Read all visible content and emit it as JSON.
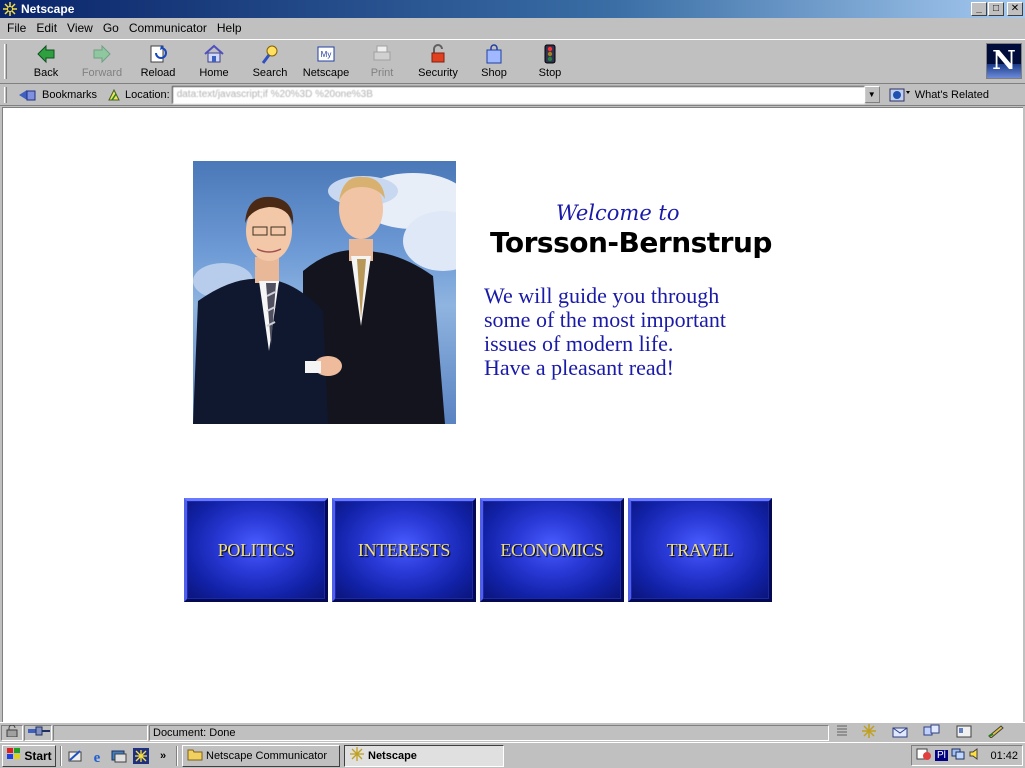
{
  "window": {
    "title": "Netscape",
    "controls": {
      "minimize": "_",
      "maximize": "□",
      "close": "✕"
    }
  },
  "menu": [
    {
      "label": "File"
    },
    {
      "label": "Edit"
    },
    {
      "label": "View"
    },
    {
      "label": "Go"
    },
    {
      "label": "Communicator"
    },
    {
      "label": "Help"
    }
  ],
  "toolbar": {
    "buttons": [
      {
        "label": "Back",
        "icon": "back-arrow-icon",
        "enabled": true
      },
      {
        "label": "Forward",
        "icon": "forward-arrow-icon",
        "enabled": false
      },
      {
        "label": "Reload",
        "icon": "reload-icon",
        "enabled": true
      },
      {
        "label": "Home",
        "icon": "home-icon",
        "enabled": true
      },
      {
        "label": "Search",
        "icon": "search-icon",
        "enabled": true
      },
      {
        "label": "Netscape",
        "icon": "my-netscape-icon",
        "enabled": true
      },
      {
        "label": "Print",
        "icon": "printer-icon",
        "enabled": false
      },
      {
        "label": "Security",
        "icon": "padlock-icon",
        "enabled": true
      },
      {
        "label": "Shop",
        "icon": "shopping-bag-icon",
        "enabled": true
      },
      {
        "label": "Stop",
        "icon": "stop-light-icon",
        "enabled": true
      }
    ],
    "logo": "N"
  },
  "location_bar": {
    "bookmarks_label": "Bookmarks",
    "location_label": "Location:",
    "url": "data:text/javascript;if %20%3D %20one%3B",
    "related_label": "What's Related"
  },
  "page": {
    "welcome": "Welcome to",
    "site_name": "Torsson-Bernstrup",
    "intro_lines": [
      "We will guide you through",
      "some of the most important",
      "issues of modern life.",
      "Have a pleasant read!"
    ],
    "nav": [
      {
        "label": "POLITICS"
      },
      {
        "label": "INTERESTS"
      },
      {
        "label": "ECONOMICS"
      },
      {
        "label": "TRAVEL"
      }
    ]
  },
  "status_bar": {
    "text": "Document: Done"
  },
  "taskbar": {
    "start_label": "Start",
    "tasks": [
      {
        "label": "Netscape Communicator",
        "active": false
      },
      {
        "label": "Netscape",
        "active": true
      }
    ],
    "tray_text": "Pl",
    "clock": "01:42"
  },
  "colors": {
    "title_bar": "#0a246a",
    "heading_blue": "#1a1aa8",
    "nav_button_blue": "#2a3ad8",
    "nav_label_gold": "#f0e080"
  }
}
